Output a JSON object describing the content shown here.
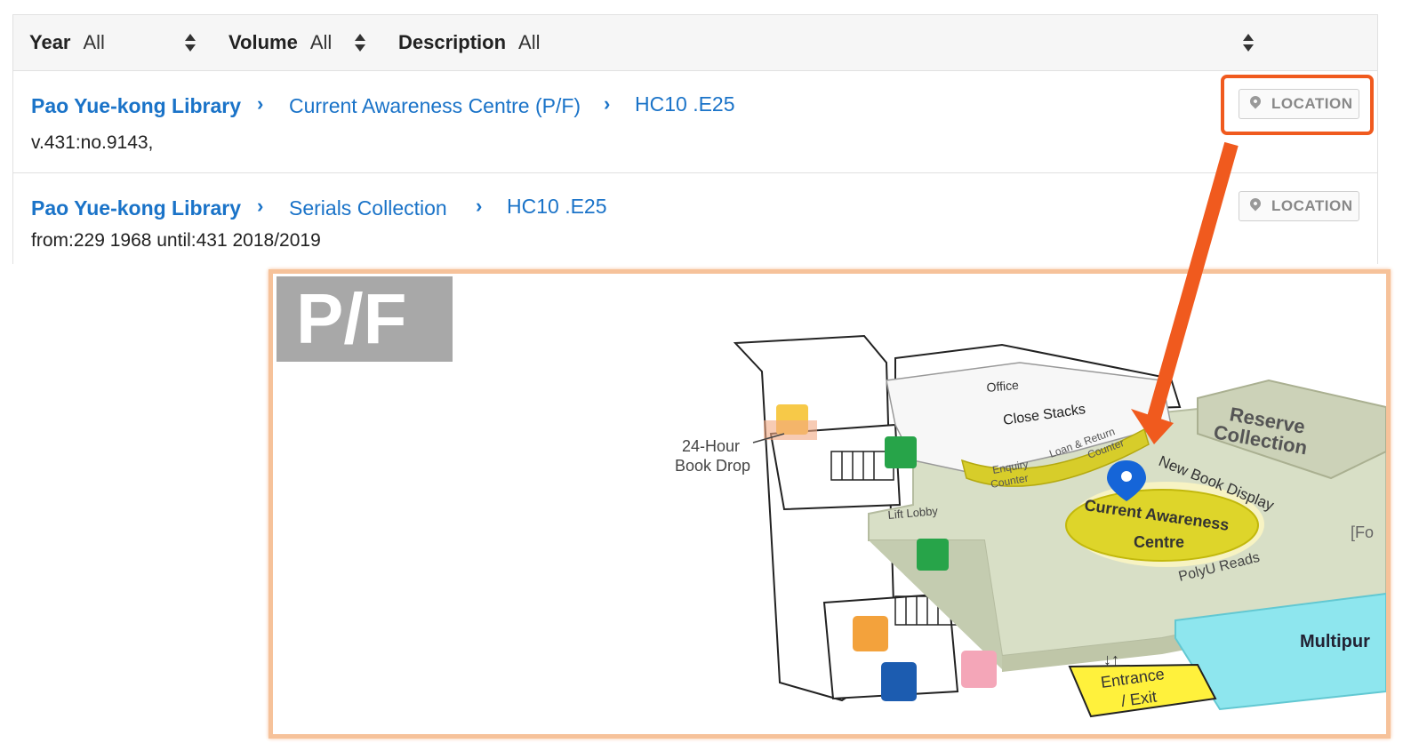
{
  "filters": {
    "year_label": "Year",
    "year_value": "All",
    "volume_label": "Volume",
    "volume_value": "All",
    "description_label": "Description",
    "description_value": "All"
  },
  "rows": [
    {
      "library": "Pao Yue-kong Library",
      "location": "Current Awareness Centre (P/F)",
      "call_number": "HC10 .E25",
      "holding": "v.431:no.9143,",
      "location_button": "LOCATION"
    },
    {
      "library": "Pao Yue-kong Library",
      "location": "Serials Collection",
      "call_number": "HC10 .E25",
      "holding": "from:229 1968 until:431 2018/2019",
      "location_button": "LOCATION"
    }
  ],
  "map": {
    "floor": "P/F",
    "labels": {
      "office": "Office",
      "close_stacks": "Close Stacks",
      "loan_return_1": "Loan & Return",
      "loan_return_2": "Counter",
      "enquiry_1": "Enquiry",
      "enquiry_2": "Counter",
      "reserve_1": "Reserve",
      "reserve_2": "Collection",
      "new_book_display": "New Book Display",
      "current_awareness_1": "Current Awareness",
      "current_awareness_2": "Centre",
      "polyu_reads": "PolyU Reads",
      "lift_lobby": "Lift Lobby",
      "book_drop_1": "24-Hour",
      "book_drop_2": "Book Drop",
      "entrance_1": "Entrance",
      "entrance_2": "/ Exit",
      "multipurpose": "Multipur",
      "fo": "[Fo"
    }
  },
  "colors": {
    "link": "#1a73c8",
    "highlight": "#f05a1e",
    "map_border": "#f6c29a",
    "floor_badge": "#a8a8a8"
  }
}
